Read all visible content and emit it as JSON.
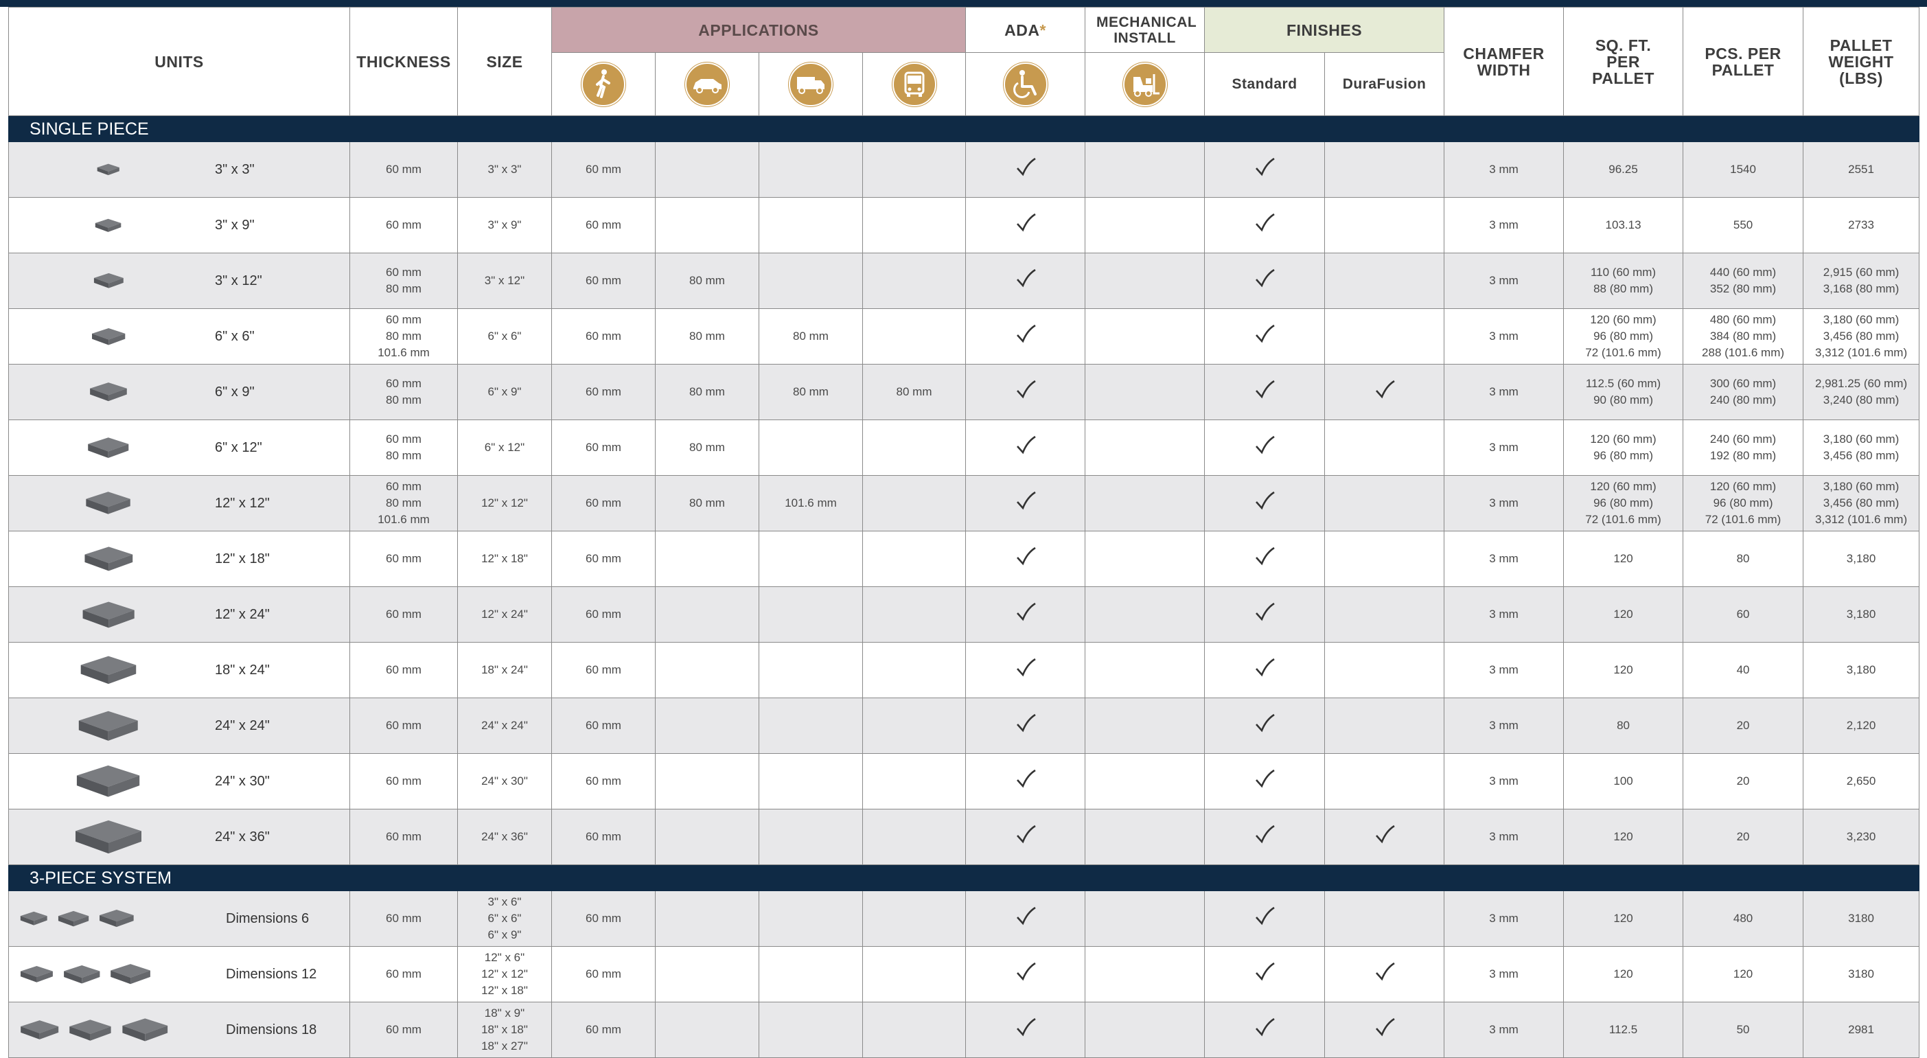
{
  "headers": {
    "units": "UNITS",
    "thickness": "THICKNESS",
    "size": "SIZE",
    "applications": "APPLICATIONS",
    "ada": "ADA",
    "ada_mark": "*",
    "mechanical_install": "MECHANICAL INSTALL",
    "finishes": "FINISHES",
    "finish_standard": "Standard",
    "finish_durafusion": "DuraFusion",
    "chamfer_width": "CHAMFER WIDTH",
    "sqft_per_pallet": "SQ. FT. PER PALLET",
    "pcs_per_pallet": "PCS. PER PALLET",
    "pallet_weight": "PALLET WEIGHT (LBS)"
  },
  "application_icons": [
    "pedestrian-icon",
    "car-icon",
    "truck-icon",
    "bus-icon"
  ],
  "ada_icon": "wheelchair-icon",
  "mechanical_icon": "forklift-icon",
  "colors": {
    "navy": "#0f2a45",
    "gold": "#c79a4f",
    "applications_header": "#c8a4aa",
    "finishes_header": "#e6ebd6",
    "stripe": "#e8e8ea"
  },
  "sections": [
    {
      "title": "SINGLE PIECE",
      "rows": [
        {
          "unit": "3\" x 3\"",
          "thickness": "60 mm",
          "size": "3\" x 3\"",
          "app": [
            "60 mm",
            "",
            "",
            ""
          ],
          "ada": true,
          "mech": false,
          "standard": true,
          "durafusion": false,
          "chamfer": "3 mm",
          "sqft": "96.25",
          "pcs": "1540",
          "weight": "2551"
        },
        {
          "unit": "3\" x 9\"",
          "thickness": "60 mm",
          "size": "3\" x 9\"",
          "app": [
            "60 mm",
            "",
            "",
            ""
          ],
          "ada": true,
          "mech": false,
          "standard": true,
          "durafusion": false,
          "chamfer": "3 mm",
          "sqft": "103.13",
          "pcs": "550",
          "weight": "2733"
        },
        {
          "unit": "3\" x 12\"",
          "thickness": "60 mm\n80 mm",
          "size": "3\" x 12\"",
          "app": [
            "60 mm",
            "80 mm",
            "",
            ""
          ],
          "ada": true,
          "mech": false,
          "standard": true,
          "durafusion": false,
          "chamfer": "3 mm",
          "sqft": "110 (60 mm)\n88 (80 mm)",
          "pcs": "440 (60 mm)\n352 (80 mm)",
          "weight": "2,915 (60 mm)\n3,168 (80 mm)"
        },
        {
          "unit": "6\" x 6\"",
          "thickness": "60 mm\n80 mm\n101.6 mm",
          "size": "6\" x 6\"",
          "app": [
            "60 mm",
            "80 mm",
            "80 mm",
            ""
          ],
          "ada": true,
          "mech": false,
          "standard": true,
          "durafusion": false,
          "chamfer": "3 mm",
          "sqft": "120 (60 mm)\n96  (80 mm)\n72 (101.6 mm)",
          "pcs": "480 (60 mm)\n384 (80 mm)\n288 (101.6 mm)",
          "weight": "3,180 (60 mm)\n3,456 (80 mm)\n3,312 (101.6 mm)"
        },
        {
          "unit": "6\" x 9\"",
          "thickness": "60 mm\n80 mm",
          "size": "6\" x 9\"",
          "app": [
            "60 mm",
            "80 mm",
            "80 mm",
            "80 mm"
          ],
          "ada": true,
          "mech": false,
          "standard": true,
          "durafusion": true,
          "chamfer": "3 mm",
          "sqft": "112.5 (60 mm)\n90 (80 mm)",
          "pcs": "300 (60 mm)\n240 (80 mm)",
          "weight": "2,981.25 (60 mm)\n3,240 (80 mm)"
        },
        {
          "unit": "6\" x 12\"",
          "thickness": "60 mm\n80 mm",
          "size": "6\" x 12\"",
          "app": [
            "60 mm",
            "80 mm",
            "",
            ""
          ],
          "ada": true,
          "mech": false,
          "standard": true,
          "durafusion": false,
          "chamfer": "3 mm",
          "sqft": "120 (60 mm)\n96 (80 mm)",
          "pcs": "240 (60 mm)\n192 (80 mm)",
          "weight": "3,180 (60 mm)\n3,456 (80 mm)"
        },
        {
          "unit": "12\" x 12\"",
          "thickness": "60 mm\n80 mm\n101.6 mm",
          "size": "12\" x 12\"",
          "app": [
            "60 mm",
            "80 mm",
            "101.6 mm",
            ""
          ],
          "ada": true,
          "mech": false,
          "standard": true,
          "durafusion": false,
          "chamfer": "3 mm",
          "sqft": "120 (60 mm)\n96 (80 mm)\n72 (101.6 mm)",
          "pcs": "120 (60 mm)\n96 (80 mm)\n72 (101.6 mm)",
          "weight": "3,180 (60 mm)\n3,456 (80 mm)\n3,312 (101.6 mm)"
        },
        {
          "unit": "12\" x 18\"",
          "thickness": "60 mm",
          "size": "12\" x 18\"",
          "app": [
            "60 mm",
            "",
            "",
            ""
          ],
          "ada": true,
          "mech": false,
          "standard": true,
          "durafusion": false,
          "chamfer": "3 mm",
          "sqft": "120",
          "pcs": "80",
          "weight": "3,180"
        },
        {
          "unit": "12\" x 24\"",
          "thickness": "60 mm",
          "size": "12\" x 24\"",
          "app": [
            "60 mm",
            "",
            "",
            ""
          ],
          "ada": true,
          "mech": false,
          "standard": true,
          "durafusion": false,
          "chamfer": "3 mm",
          "sqft": "120",
          "pcs": "60",
          "weight": "3,180"
        },
        {
          "unit": "18\" x 24\"",
          "thickness": "60 mm",
          "size": "18\" x 24\"",
          "app": [
            "60 mm",
            "",
            "",
            ""
          ],
          "ada": true,
          "mech": false,
          "standard": true,
          "durafusion": false,
          "chamfer": "3 mm",
          "sqft": "120",
          "pcs": "40",
          "weight": "3,180"
        },
        {
          "unit": "24\" x 24\"",
          "thickness": "60 mm",
          "size": "24\" x 24\"",
          "app": [
            "60 mm",
            "",
            "",
            ""
          ],
          "ada": true,
          "mech": false,
          "standard": true,
          "durafusion": false,
          "chamfer": "3 mm",
          "sqft": "80",
          "pcs": "20",
          "weight": "2,120"
        },
        {
          "unit": "24\" x 30\"",
          "thickness": "60 mm",
          "size": "24\" x 30\"",
          "app": [
            "60 mm",
            "",
            "",
            ""
          ],
          "ada": true,
          "mech": false,
          "standard": true,
          "durafusion": false,
          "chamfer": "3 mm",
          "sqft": "100",
          "pcs": "20",
          "weight": "2,650"
        },
        {
          "unit": "24\" x 36\"",
          "thickness": "60 mm",
          "size": "24\" x 36\"",
          "app": [
            "60 mm",
            "",
            "",
            ""
          ],
          "ada": true,
          "mech": false,
          "standard": true,
          "durafusion": true,
          "chamfer": "3 mm",
          "sqft": "120",
          "pcs": "20",
          "weight": "3,230"
        }
      ]
    },
    {
      "title": "3-PIECE SYSTEM",
      "rows": [
        {
          "unit": "Dimensions 6",
          "thumbs": 3,
          "thickness": "60 mm",
          "size": "3\" x 6\"\n6\" x 6\"\n6\" x 9\"",
          "app": [
            "60 mm",
            "",
            "",
            ""
          ],
          "ada": true,
          "mech": false,
          "standard": true,
          "durafusion": false,
          "chamfer": "3 mm",
          "sqft": "120",
          "pcs": "480",
          "weight": "3180"
        },
        {
          "unit": "Dimensions 12",
          "thumbs": 3,
          "thickness": "60 mm",
          "size": "12\" x 6\"\n12\" x 12\"\n12\" x 18\"",
          "app": [
            "60 mm",
            "",
            "",
            ""
          ],
          "ada": true,
          "mech": false,
          "standard": true,
          "durafusion": true,
          "chamfer": "3 mm",
          "sqft": "120",
          "pcs": "120",
          "weight": "3180"
        },
        {
          "unit": "Dimensions 18",
          "thumbs": 3,
          "thickness": "60 mm",
          "size": "18\" x 9\"\n18\" x 18\"\n18\" x 27\"",
          "app": [
            "60 mm",
            "",
            "",
            ""
          ],
          "ada": true,
          "mech": false,
          "standard": true,
          "durafusion": true,
          "chamfer": "3 mm",
          "sqft": "112.5",
          "pcs": "50",
          "weight": "2981"
        }
      ]
    }
  ]
}
